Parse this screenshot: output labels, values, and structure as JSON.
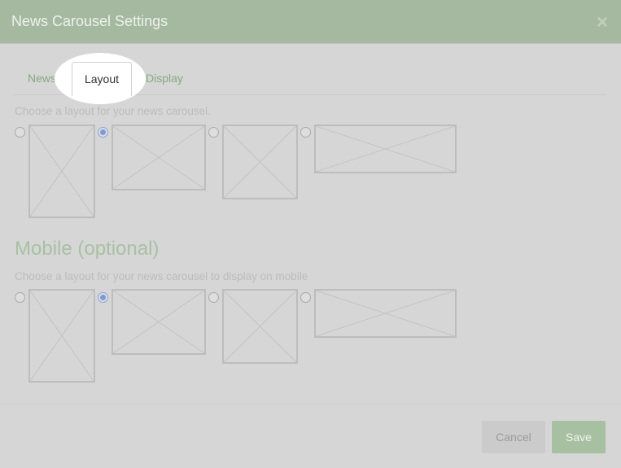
{
  "modal": {
    "title": "News Carousel Settings",
    "close_glyph": "×"
  },
  "tabs": {
    "news_label": "News",
    "layout_label": "Layout",
    "display_label": "Display",
    "active": "Layout"
  },
  "layout_section": {
    "hint": "Choose a layout for your news carousel.",
    "selected_index": 1
  },
  "mobile_section": {
    "title": "Mobile (optional)",
    "hint": "Choose a layout for your news carousel to display on mobile",
    "selected_index": 1
  },
  "footer": {
    "cancel_label": "Cancel",
    "save_label": "Save"
  },
  "colors": {
    "header_bg": "#a5b9a0",
    "accent_green": "#86a981",
    "radio_selected": "#7f9ad6",
    "overlay_bg": "#d6d6d6"
  },
  "icons": [
    "close-icon",
    "layout-placeholder-icon"
  ]
}
